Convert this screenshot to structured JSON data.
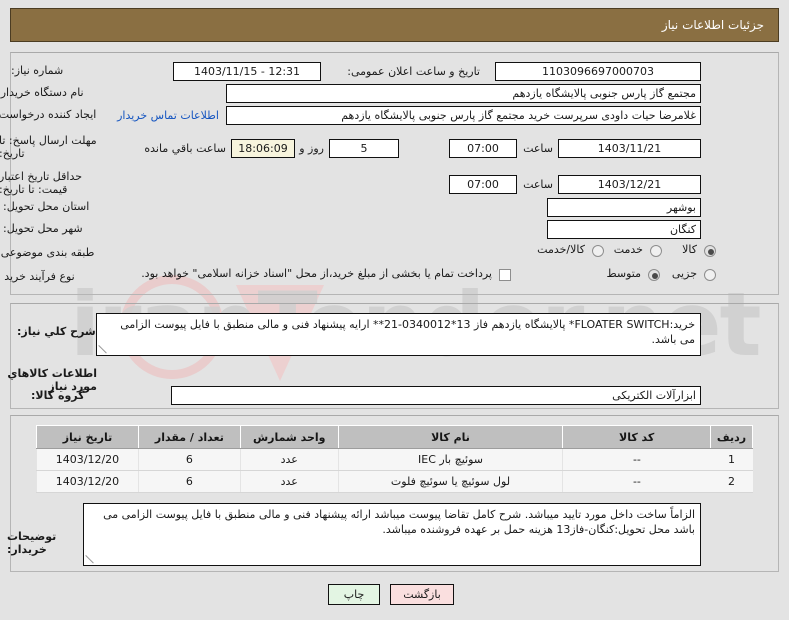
{
  "header": {
    "title": "جزئیات اطلاعات نیاز"
  },
  "form": {
    "need_number_label": "شماره نیاز:",
    "need_number_value": "1103096697000703",
    "announce_datetime_label": "تاریخ و ساعت اعلان عمومی:",
    "announce_datetime_value": "1403/11/15 - 12:31",
    "buyer_org_label": "نام دستگاه خریدار:",
    "buyer_org_value": "مجتمع گاز پارس جنوبی  پالایشگاه یازدهم",
    "requester_label": "ایجاد کننده درخواست:",
    "requester_value": "غلامرضا حیات داودی سرپرست خرید مجتمع گاز پارس جنوبی  پالایشگاه یازدهم",
    "buyer_contact_link": "اطلاعات تماس خریدار",
    "response_deadline_label": "مهلت ارسال پاسخ: تا تاریخ:",
    "response_deadline_date": "1403/11/21",
    "response_deadline_time_label": "ساعت",
    "response_deadline_time": "07:00",
    "remaining_days": "5",
    "remaining_days_label": "روز و",
    "remaining_time": "18:06:09",
    "remaining_time_label": "ساعت باقي مانده",
    "price_validity_label": "حداقل تاریخ اعتبار قیمت: تا تاریخ:",
    "price_validity_date": "1403/12/21",
    "price_validity_time_label": "ساعت",
    "price_validity_time": "07:00",
    "province_label": "استان محل تحویل:",
    "province_value": "بوشهر",
    "city_label": "شهر محل تحویل:",
    "city_value": "کنگان",
    "subject_class_label": "طبقه بندی موضوعی:",
    "subject_options": [
      {
        "label": "کالا",
        "selected": true
      },
      {
        "label": "خدمت",
        "selected": false
      },
      {
        "label": "کالا/خدمت",
        "selected": false
      }
    ],
    "process_type_label": "نوع فرآیند خرید :",
    "process_options": [
      {
        "label": "جزیی",
        "selected": false
      },
      {
        "label": "متوسط",
        "selected": true
      }
    ],
    "treasury_checkbox_label": "پرداخت تمام یا بخشی از مبلغ خرید،از محل \"اسناد خزانه اسلامی\" خواهد بود.",
    "treasury_checked": false
  },
  "description": {
    "label": "شرح کلي نیاز:",
    "text": "خرید:FLOATER SWITCH* پالایشگاه یازدهم فاز 13*0340012-21** ارایه پیشنهاد فنی و مالی منطبق با فایل پیوست الزامی می باشد."
  },
  "goods_section": {
    "heading": "اطلاعات کالاهاي مورد نیاز",
    "group_label": "گروه کالا:",
    "group_value": "ابزارآلات الکتریکی"
  },
  "items_table": {
    "columns": [
      "ردیف",
      "کد کالا",
      "نام کالا",
      "واحد شمارش",
      "تعداد / مقدار",
      "تاریخ نیاز"
    ],
    "rows": [
      {
        "row": "1",
        "code": "--",
        "name": "سوئیچ بار IEC",
        "unit": "عدد",
        "qty": "6",
        "need_date": "1403/12/20"
      },
      {
        "row": "2",
        "code": "--",
        "name": "لول سوئیچ یا سوئیچ فلوت",
        "unit": "عدد",
        "qty": "6",
        "need_date": "1403/12/20"
      }
    ]
  },
  "buyer_notes": {
    "label": "توضیحات خریدار:",
    "text": "الزاماً ساخت داخل مورد تایید میباشد. شرح کامل تقاضا پیوست میباشد ارائه پیشنهاد فنی و مالی منطبق با فایل پیوست الزامی می باشد محل تحویل:کنگان-فاز13 هزینه حمل بر عهده فروشنده میباشد."
  },
  "footer": {
    "print_label": "چاپ",
    "back_label": "بازگشت"
  },
  "watermark": {
    "text": "iranTender.net"
  }
}
